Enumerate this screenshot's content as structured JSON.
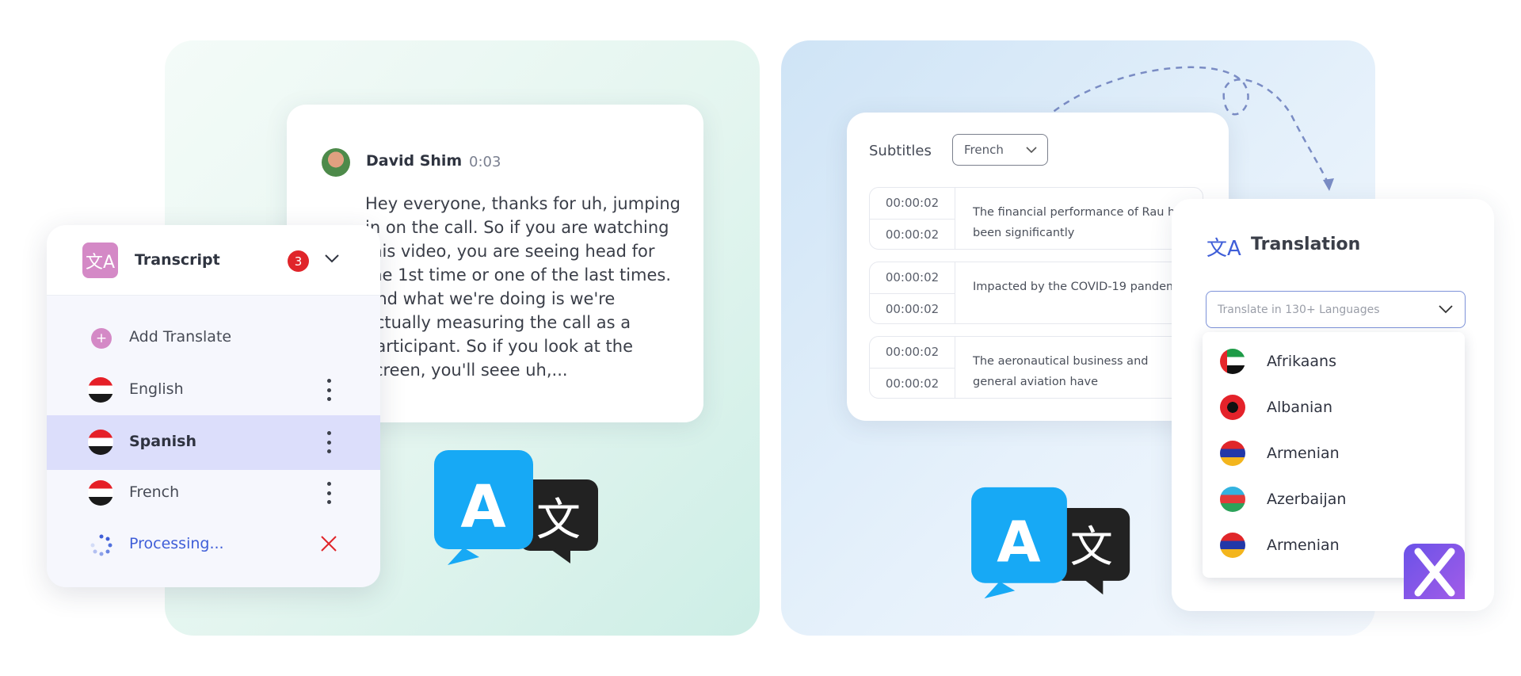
{
  "chat": {
    "name": "David Shim",
    "time": "0:03",
    "message": "Hey everyone, thanks for uh, jumping in on the call. So if you are watching this video, you are seeing head for the 1st time or one of the last times. And what we're doing is we're actually measuring the call as a participant. So if you look at the screen, you'll seee uh,..."
  },
  "transcript": {
    "icon": "translate-icon",
    "title": "Transcript",
    "badge": "3",
    "add_label": "Add Translate",
    "languages": [
      {
        "label": "English",
        "selected": false
      },
      {
        "label": "Spanish",
        "selected": true
      },
      {
        "label": "French",
        "selected": false
      }
    ],
    "processing": "Processing...",
    "colors": {
      "accent": "#d489c6",
      "badge": "#e0252a",
      "selected": "#dcdefb",
      "processing": "#3f5ed8",
      "cancel": "#e0252a"
    }
  },
  "subtitles": {
    "title": "Subtitles",
    "selected": "French",
    "rows": [
      {
        "start": "00:00:02",
        "end": "00:00:02",
        "text": "The financial performance of Rau has been significantly"
      },
      {
        "start": "00:00:02",
        "end": "00:00:02",
        "text": "Impacted by the COVID-19 pandemic."
      },
      {
        "start": "00:00:02",
        "end": "00:00:02",
        "text": "The aeronautical business and general aviation have"
      }
    ]
  },
  "translation": {
    "title": "Translation",
    "placeholder": "Translate in 130+ Languages",
    "options": [
      {
        "label": "Afrikaans",
        "flag": "uae"
      },
      {
        "label": "Albanian",
        "flag": "albania"
      },
      {
        "label": "Armenian",
        "flag": "armenia"
      },
      {
        "label": "Azerbaijan",
        "flag": "azerbaijan"
      },
      {
        "label": "Armenian",
        "flag": "armenia"
      }
    ]
  },
  "logo": {
    "name": "x-logo",
    "color": "#7b55e8"
  }
}
